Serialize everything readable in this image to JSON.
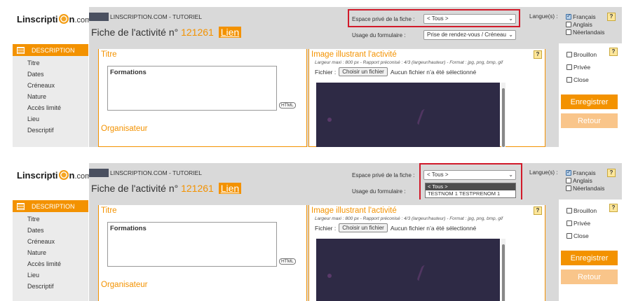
{
  "logo": {
    "text_before": "Linscripti",
    "text_after": "n",
    "domain": ".com"
  },
  "header": {
    "breadcrumb": "LINSCRIPTION.COM - TUTORIEL",
    "fiche_prefix": "Fiche de l'activité n°",
    "fiche_number": "121261",
    "lien_label": "Lien",
    "espace_label": "Espace privé de la fiche :",
    "espace_value": "< Tous >",
    "usage_label": "Usage du formulaire :",
    "usage_value": "Prise de rendez-vous / Créneau"
  },
  "dropdown": {
    "options": [
      "< Tous >",
      "TESTNOM 1 TESTPRENOM 1"
    ]
  },
  "languages": {
    "label": "Langue(s) :",
    "items": [
      {
        "label": "Français",
        "checked": true
      },
      {
        "label": "Anglais",
        "checked": false
      },
      {
        "label": "Néerlandais",
        "checked": false
      }
    ]
  },
  "help": "?",
  "nav": {
    "header": "DESCRIPTION",
    "items": [
      "Titre",
      "Dates",
      "Créneaux",
      "Nature",
      "Accès limité",
      "Lieu",
      "Descriptif"
    ]
  },
  "titre_section": {
    "title": "Titre",
    "value": "Formations",
    "html_button": "HTML",
    "next_section": "Organisateur"
  },
  "image_section": {
    "title": "Image illustrant l'activité",
    "note": "Largeur maxi : 800 px - Rapport préconisé : 4/3 (largeur/hauteur) - Format : jpg, png, bmp, gif",
    "file_label": "Fichier :",
    "file_button": "Choisir un fichier",
    "file_status": "Aucun fichier n’a été sélectionné"
  },
  "options": [
    {
      "label": "Brouillon",
      "checked": false
    },
    {
      "label": "Privée",
      "checked": false
    },
    {
      "label": "Close",
      "checked": false
    }
  ],
  "buttons": {
    "save": "Enregistrer",
    "back": "Retour"
  },
  "colors": {
    "accent": "#f39200",
    "highlight": "#d11a2a",
    "header_bg": "#d9d9d9"
  }
}
